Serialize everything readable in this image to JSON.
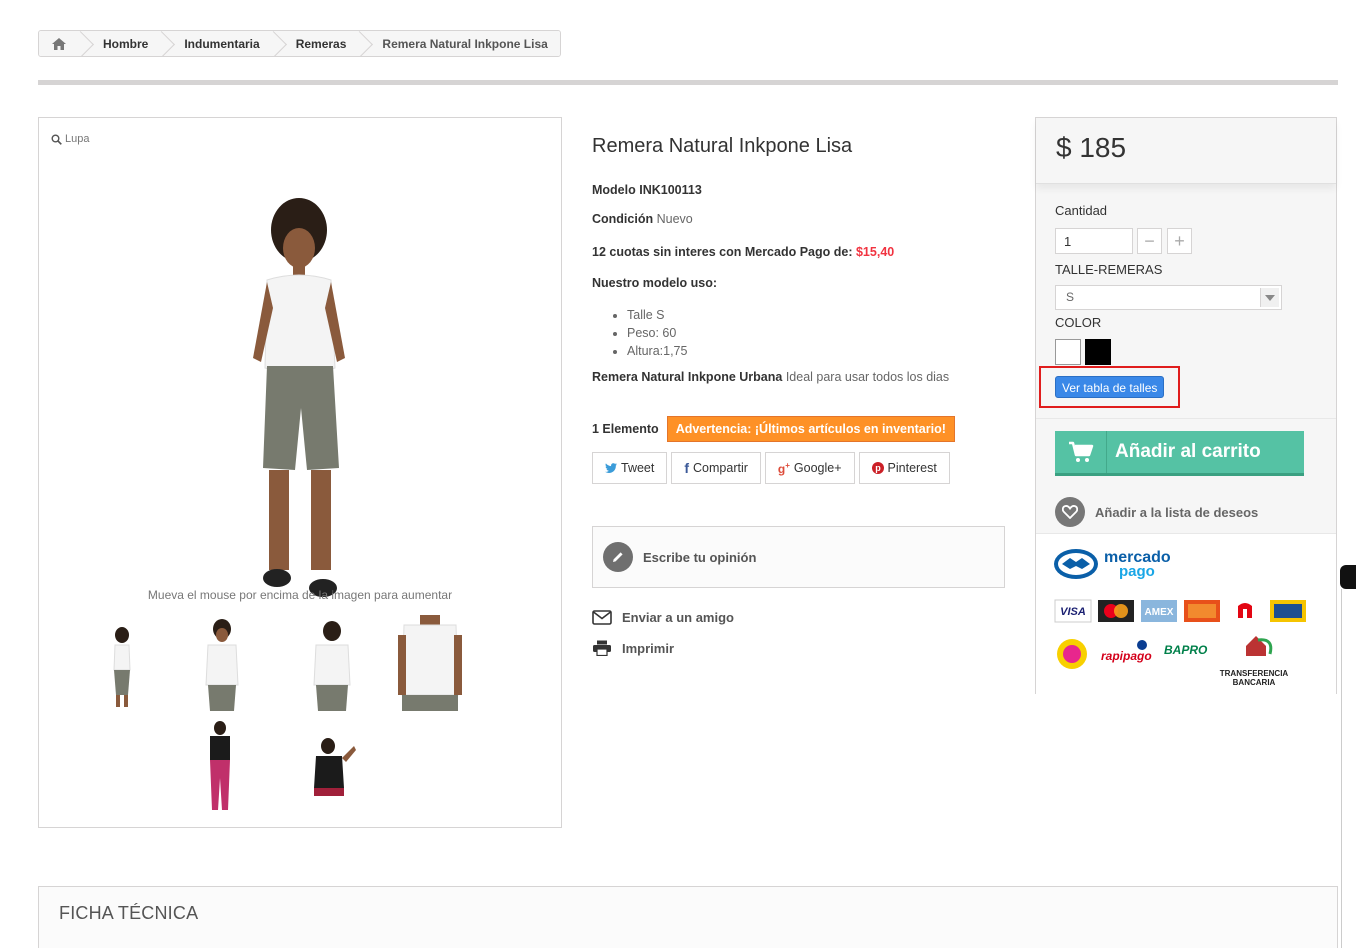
{
  "breadcrumb": {
    "items": [
      "Hombre",
      "Indumentaria",
      "Remeras",
      "Remera Natural Inkpone Lisa"
    ]
  },
  "image_box": {
    "zoom_label": "Lupa",
    "hint": "Mueva el mouse por encima de la imagen para aumentar"
  },
  "product": {
    "title": "Remera Natural Inkpone Lisa",
    "model_label": "Modelo",
    "model_value": "INK100113",
    "condition_label": "Condición",
    "condition_value": "Nuevo",
    "installments_text": "12 cuotas sin interes con Mercado Pago de:",
    "installments_value": "$15,40",
    "model_use_label": "Nuestro modelo uso:",
    "specs": [
      "Talle S",
      "Peso: 60",
      "Altura:1,75"
    ],
    "desc_bold": "Remera Natural Inkpone Urbana",
    "desc_rest": "Ideal para usar todos los dias",
    "stock": "1 Elemento",
    "warning": "Advertencia: ¡Últimos artículos en inventario!",
    "share_buttons": [
      "Tweet",
      "Compartir",
      "Google+",
      "Pinterest"
    ],
    "review_label": "Escribe tu opinión",
    "send_friend": "Enviar a un amigo",
    "print": "Imprimir"
  },
  "buy_box": {
    "price": "$ 185",
    "quantity_label": "Cantidad",
    "quantity_value": "1",
    "size_label": "TALLE-REMERAS",
    "size_value": "S",
    "color_label": "COLOR",
    "colors": [
      "#ffffff",
      "#000000"
    ],
    "size_table_button": "Ver tabla de talles",
    "add_to_cart": "Añadir al carrito",
    "wishlist": "Añadir a la lista de deseos",
    "payment": {
      "brand_top": "mercado",
      "brand_bottom": "pago",
      "cards": [
        "VISA",
        "AMEX"
      ],
      "rapipago": "rapipago",
      "bapro": "BAPRO",
      "transfer_line1": "TRANSFERENCIA",
      "transfer_line2": "BANCARIA"
    }
  },
  "ficha": {
    "title": "FICHA TÉCNICA"
  },
  "colors": {
    "accent_green": "#55c2a4",
    "warning_orange": "#fe9126",
    "link_blue": "#3a88e8",
    "price_red": "#f13340",
    "highlight_red": "#e01d1d"
  }
}
